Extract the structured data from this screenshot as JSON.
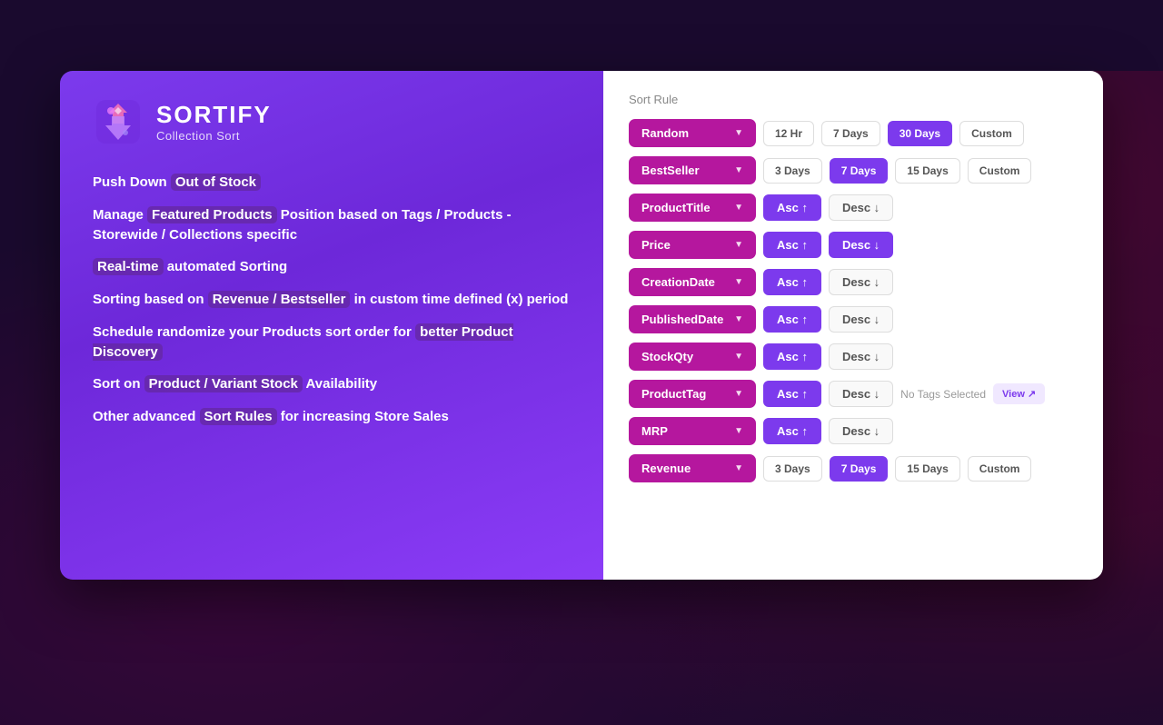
{
  "background": {
    "color": "#1a0a2e"
  },
  "logo": {
    "title": "SORTIFY",
    "subtitle": "Collection Sort"
  },
  "features": [
    {
      "id": "feature-1",
      "parts": [
        {
          "text": "Push Down ",
          "highlight": false
        },
        {
          "text": "Out of Stock",
          "highlight": true
        }
      ]
    },
    {
      "id": "feature-2",
      "parts": [
        {
          "text": "Manage ",
          "highlight": false
        },
        {
          "text": "Featured Products",
          "highlight": true
        },
        {
          "text": " Position based on Tags / Products - Storewide / Collections specific",
          "highlight": false
        }
      ]
    },
    {
      "id": "feature-3",
      "parts": [
        {
          "text": "Real-time",
          "highlight": true
        },
        {
          "text": " automated Sorting",
          "highlight": false
        }
      ]
    },
    {
      "id": "feature-4",
      "parts": [
        {
          "text": "Sorting based on ",
          "highlight": false
        },
        {
          "text": "Revenue / Bestseller",
          "highlight": true
        },
        {
          "text": " in custom time defined (x) period",
          "highlight": false
        }
      ]
    },
    {
      "id": "feature-5",
      "parts": [
        {
          "text": "Schedule randomize your Products sort order for ",
          "highlight": false
        },
        {
          "text": "better Product Discovery",
          "highlight": true
        }
      ]
    },
    {
      "id": "feature-6",
      "parts": [
        {
          "text": "Sort on ",
          "highlight": false
        },
        {
          "text": "Product / Variant Stock",
          "highlight": true
        },
        {
          "text": " Availability",
          "highlight": false
        }
      ]
    },
    {
      "id": "feature-7",
      "parts": [
        {
          "text": "Other advanced ",
          "highlight": false
        },
        {
          "text": "Sort Rules",
          "highlight": true
        },
        {
          "text": " for increasing Store Sales",
          "highlight": false
        }
      ]
    }
  ],
  "sort_rule_section": {
    "label": "Sort Rule",
    "rows": [
      {
        "id": "row-random",
        "dropdown_label": "Random",
        "type": "pills",
        "pills": [
          {
            "label": "12 Hr",
            "active": false
          },
          {
            "label": "7 Days",
            "active": false
          },
          {
            "label": "30 Days",
            "active": true
          },
          {
            "label": "Custom",
            "active": false
          }
        ]
      },
      {
        "id": "row-bestseller",
        "dropdown_label": "BestSeller",
        "type": "pills",
        "pills": [
          {
            "label": "3 Days",
            "active": false
          },
          {
            "label": "7 Days",
            "active": true
          },
          {
            "label": "15 Days",
            "active": false
          },
          {
            "label": "Custom",
            "active": false
          }
        ]
      },
      {
        "id": "row-producttitle",
        "dropdown_label": "ProductTitle",
        "type": "asc-desc",
        "asc_active": true,
        "desc_active": false,
        "asc_label": "Asc ↑",
        "desc_label": "Desc ↓"
      },
      {
        "id": "row-price",
        "dropdown_label": "Price",
        "type": "asc-desc",
        "asc_active": true,
        "desc_active": true,
        "asc_label": "Asc ↑",
        "desc_label": "Desc ↓"
      },
      {
        "id": "row-creationdate",
        "dropdown_label": "CreationDate",
        "type": "asc-desc",
        "asc_active": true,
        "desc_active": false,
        "asc_label": "Asc ↑",
        "desc_label": "Desc ↓"
      },
      {
        "id": "row-publisheddate",
        "dropdown_label": "PublishedDate",
        "type": "asc-desc",
        "asc_active": true,
        "desc_active": false,
        "asc_label": "Asc ↑",
        "desc_label": "Desc ↓"
      },
      {
        "id": "row-stockqty",
        "dropdown_label": "StockQty",
        "type": "asc-desc",
        "asc_active": true,
        "desc_active": false,
        "asc_label": "Asc ↑",
        "desc_label": "Desc ↓"
      },
      {
        "id": "row-producttag",
        "dropdown_label": "ProductTag",
        "type": "asc-desc-tag",
        "asc_active": true,
        "desc_active": false,
        "asc_label": "Asc ↑",
        "desc_label": "Desc ↓",
        "no_tags_text": "No Tags Selected",
        "view_label": "View ↗"
      },
      {
        "id": "row-mrp",
        "dropdown_label": "MRP",
        "type": "asc-desc",
        "asc_active": true,
        "desc_active": false,
        "asc_label": "Asc ↑",
        "desc_label": "Desc ↓"
      },
      {
        "id": "row-revenue",
        "dropdown_label": "Revenue",
        "type": "pills",
        "pills": [
          {
            "label": "3 Days",
            "active": false
          },
          {
            "label": "7 Days",
            "active": true
          },
          {
            "label": "15 Days",
            "active": false
          },
          {
            "label": "Custom",
            "active": false
          }
        ]
      }
    ]
  }
}
